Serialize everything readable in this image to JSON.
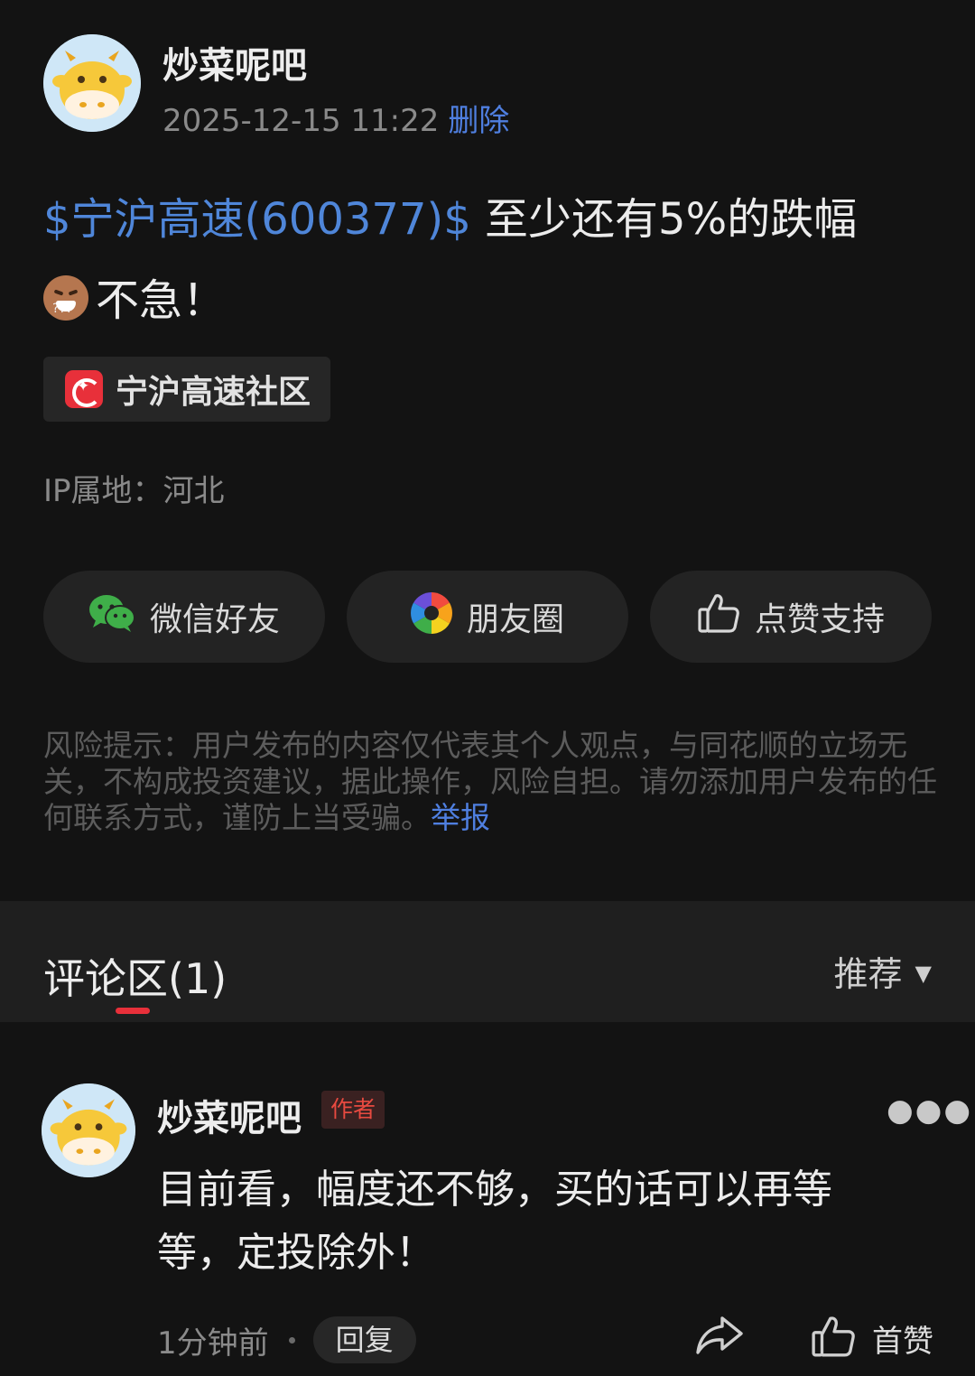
{
  "post": {
    "author": "炒菜呢吧",
    "timestamp": "2025-12-15 11:22",
    "delete_label": "删除",
    "stock_tag": "$宁沪高速(600377)$",
    "text_line1": " 至少还有5%的跌幅",
    "text_line2": "不急！",
    "emoji_icon": "grinning-face-emoji",
    "community_label": "宁沪高速社区",
    "ip_location": "IP属地：河北"
  },
  "share": {
    "wechat_label": "微信好友",
    "moments_label": "朋友圈",
    "like_label": "点赞支持"
  },
  "risk_notice": {
    "text": "风险提示：用户发布的内容仅代表其个人观点，与同花顺的立场无关，不构成投资建议，据此操作，风险自担。请勿添加用户发布的任何联系方式，谨防上当受骗。",
    "report_label": "举报"
  },
  "comments": {
    "title": "评论区(1)",
    "sort_label": "推荐",
    "items": [
      {
        "author": "炒菜呢吧",
        "badge": "作者",
        "text": "目前看，幅度还不够，买的话可以再等等，定投除外！",
        "time": "1分钟前",
        "reply_label": "回复",
        "like_label": "首赞"
      }
    ]
  },
  "colors": {
    "background": "#131313",
    "link_blue": "#4f7fe0",
    "stock_blue": "#4f86d9",
    "accent_red": "#e8303a"
  }
}
